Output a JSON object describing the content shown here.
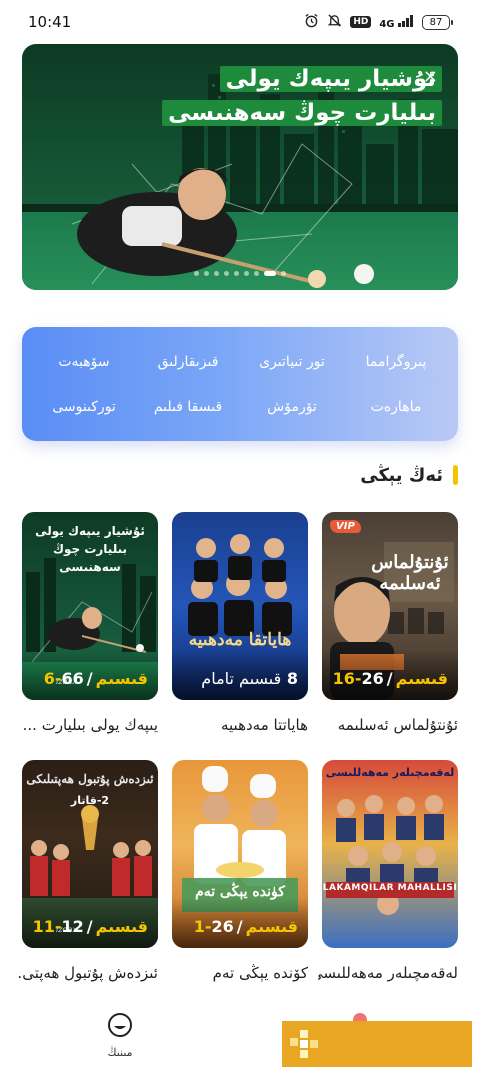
{
  "status_bar": {
    "time": "10:41",
    "hd": "HD",
    "network": "4G",
    "battery": "87"
  },
  "banner": {
    "line1": "ئۇشيار يىپەك يولى",
    "line2": "بىليارت چوڭ سەھنىسى",
    "close": "×",
    "slide_count": 9,
    "active_slide": 7
  },
  "categories": [
    "پىروگرامما",
    "تور تىياتىرى",
    "قىزىقارلىق",
    "سۆھبەت",
    "ماھارەت",
    "تۆرمۆش",
    "قىسقا فىلىم",
    "توركىنوسى"
  ],
  "section": {
    "title": "ئەڭ يېڭى"
  },
  "posters": [
    {
      "title": "ئۇنتۇلماس ئەسلىمە",
      "art_text": "ئۇنتۇلماس ئەسلىمە",
      "count": "26",
      "ep": "16-قىسىم",
      "vip": "VIP"
    },
    {
      "title": "ھاياتتا مەدھىيە",
      "art_text": "ھاياتقا مەدھىيە",
      "count": "8",
      "ep": "قىسىم تامام"
    },
    {
      "title": "يىپەك يولى بىليارت ...",
      "art_text_1": "ئۇشيار يىپەك يولى",
      "art_text_2": "بىليارت چوڭ سەھنىسى",
      "count": "66",
      "ep": "6-قىسىم",
      "logo": "izdax"
    },
    {
      "title": "لەقەمچىلەر مەھەللىسى",
      "art_text": "LAKAMQILAR MAHALLISI",
      "art_text_top": "لەقەمچىلەر مەھەللىسى"
    },
    {
      "title": "كۆندە يېڭى تەم",
      "art_text": "كۈندە يېڭى تەم",
      "count": "26",
      "ep": "1-قىسىم",
      "logo": "izdax"
    },
    {
      "title": "ئىزدەش پۇتبول ھەپتى...",
      "art_text": "ئىزدەش پۇتبول ھەپتىلىكى",
      "sub": "2-قاتار",
      "count": "12",
      "ep": "11-قىسىم",
      "logo": "izdax"
    }
  ],
  "bottom_nav": {
    "mine_label": "مىنىڭ"
  },
  "colors": {
    "accent_yellow": "#f5c400",
    "category_blue": "#5a8df5",
    "banner_green": "#155534",
    "floating_widget": "#e9a623"
  }
}
